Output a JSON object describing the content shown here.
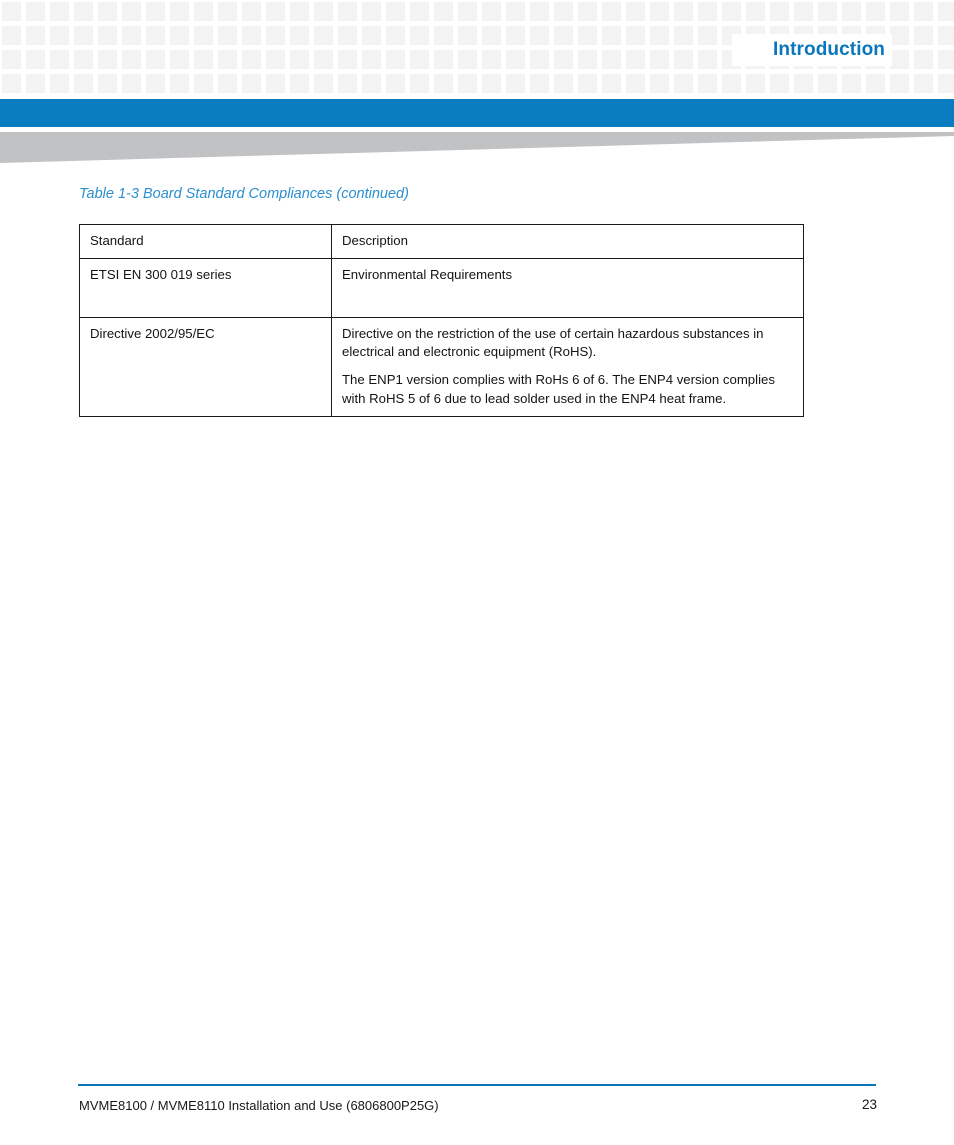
{
  "header": {
    "title": "Introduction",
    "accent_color": "#0a7cc0",
    "title_color": "#0a76bd",
    "square_color": "#f3f3f3",
    "wedge_color": "#c0c2c4"
  },
  "caption": {
    "text": "Table 1-3 Board Standard Compliances (continued)",
    "color": "#2b8fcf"
  },
  "table": {
    "columns": [
      "Standard",
      "Description"
    ],
    "rows": [
      {
        "standard": "ETSI EN 300 019 series",
        "description": [
          "Environmental Requirements"
        ]
      },
      {
        "standard": "Directive 2002/95/EC",
        "description": [
          "Directive on the restriction of the use of certain hazardous substances in electrical and electronic equipment (RoHS).",
          "The ENP1 version complies with RoHs 6 of 6. The ENP4 version complies with RoHS 5 of 6 due to lead solder used in the ENP4 heat frame."
        ]
      }
    ]
  },
  "footer": {
    "document": "MVME8100 / MVME8110 Installation and Use (6806800P25G)",
    "page_number": "23",
    "rule_color": "#0b74b8"
  }
}
